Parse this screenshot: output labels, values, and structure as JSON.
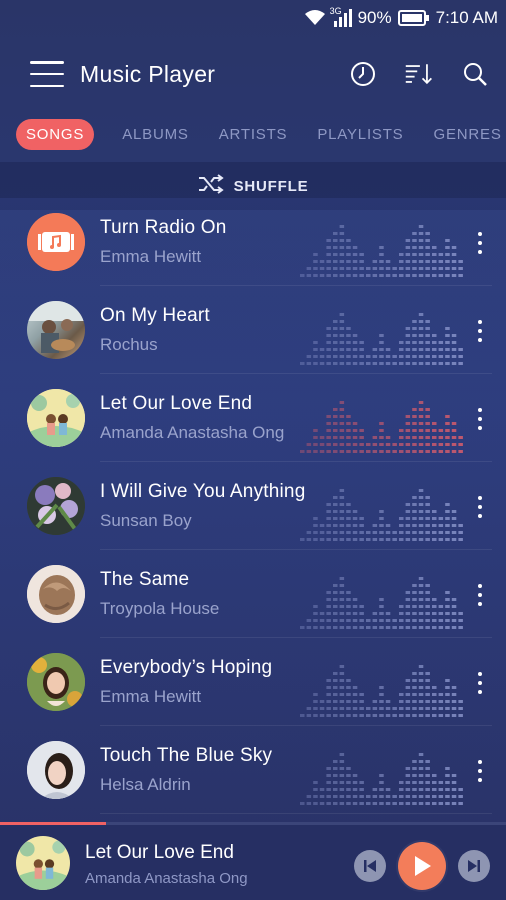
{
  "status": {
    "network": "3G",
    "battery": "90%",
    "time": "7:10 AM"
  },
  "app": {
    "title": "Music Player"
  },
  "tabs": [
    {
      "label": "SONGS",
      "active": true
    },
    {
      "label": "ALBUMS",
      "active": false
    },
    {
      "label": "ARTISTS",
      "active": false
    },
    {
      "label": "PLAYLISTS",
      "active": false
    },
    {
      "label": "GENRES",
      "active": false
    }
  ],
  "shuffle": {
    "label": "SHUFFLE"
  },
  "songs": [
    {
      "title": "Turn Radio On",
      "artist": "Emma Hewitt",
      "art": "music-icon",
      "playing": false
    },
    {
      "title": "On My Heart",
      "artist": "Rochus",
      "art": "guitar-photo",
      "playing": false
    },
    {
      "title": "Let Our Love End",
      "artist": "Amanda Anastasha Ong",
      "art": "illustration",
      "playing": true
    },
    {
      "title": "I Will Give You Anything",
      "artist": "Sunsan Boy",
      "art": "flowers-photo",
      "playing": false
    },
    {
      "title": "The Same",
      "artist": "Troypola House",
      "art": "hair-photo",
      "playing": false
    },
    {
      "title": "Everybody’s Hoping",
      "artist": "Emma Hewitt",
      "art": "portrait-photo",
      "playing": false
    },
    {
      "title": "Touch The Blue Sky",
      "artist": "Helsa Aldrin",
      "art": "portrait-photo",
      "playing": false
    }
  ],
  "now_playing": {
    "title": "Let Our Love End",
    "artist": "Amanda Anastasha Ong",
    "progress": 0.21
  },
  "colors": {
    "accent": "#f06264",
    "play_button": "#f37d5a",
    "inactive_tab": "#8e98c4"
  }
}
